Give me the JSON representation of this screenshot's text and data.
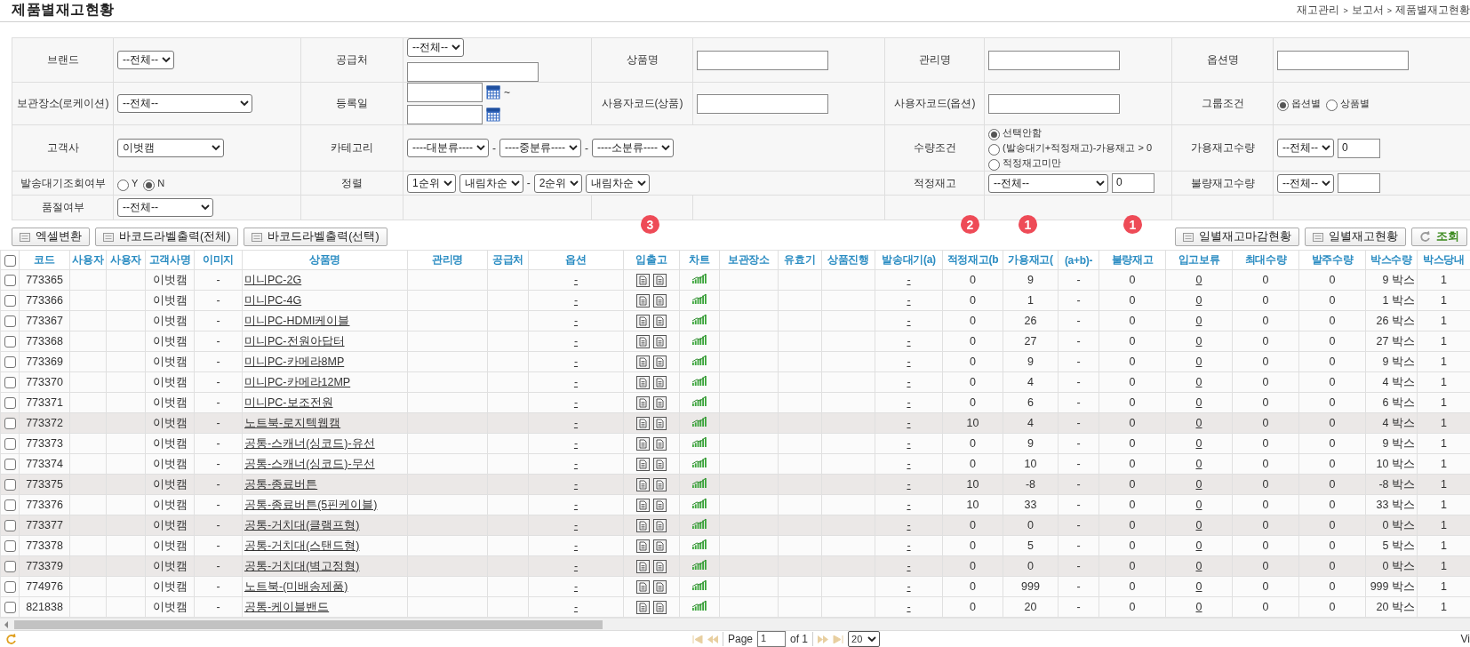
{
  "title": "제품별재고현황",
  "breadcrumb": [
    "재고관리",
    ">",
    "보고서",
    ">",
    "제품별재고현황"
  ],
  "filter": {
    "rows": [
      {
        "cells": [
          {
            "kind": "label",
            "text": "브랜드"
          },
          {
            "kind": "controls",
            "items": [
              {
                "kind": "select",
                "value": "--전체--"
              }
            ]
          },
          {
            "kind": "label",
            "text": "공급처"
          },
          {
            "kind": "controls",
            "items": [
              {
                "kind": "select",
                "value": "--전체--"
              },
              {
                "kind": "break"
              },
              {
                "kind": "input"
              }
            ]
          },
          {
            "kind": "label",
            "text": "상품명"
          },
          {
            "kind": "controls",
            "items": [
              {
                "kind": "input"
              }
            ]
          },
          {
            "kind": "label",
            "text": "관리명"
          },
          {
            "kind": "controls",
            "items": [
              {
                "kind": "input"
              }
            ]
          },
          {
            "kind": "label",
            "text": "옵션명"
          },
          {
            "kind": "controls",
            "items": [
              {
                "kind": "input"
              }
            ]
          }
        ]
      },
      {
        "cells": [
          {
            "kind": "label",
            "text": "보관장소(로케이션)"
          },
          {
            "kind": "controls",
            "items": [
              {
                "kind": "select",
                "value": "--전체--"
              }
            ]
          },
          {
            "kind": "label",
            "text": "등록일"
          },
          {
            "kind": "controls",
            "items": [
              {
                "kind": "input"
              },
              {
                "kind": "calendar"
              },
              {
                "kind": "text",
                "text": "~"
              },
              {
                "kind": "input"
              },
              {
                "kind": "calendar"
              }
            ]
          },
          {
            "kind": "label",
            "text": "사용자코드(상품)"
          },
          {
            "kind": "controls",
            "items": [
              {
                "kind": "input"
              }
            ]
          },
          {
            "kind": "label",
            "text": "사용자코드(옵션)"
          },
          {
            "kind": "controls",
            "items": [
              {
                "kind": "input"
              }
            ]
          },
          {
            "kind": "label",
            "text": "그룹조건"
          },
          {
            "kind": "controls",
            "items": [
              {
                "kind": "radio",
                "label": "옵션별",
                "selected": true
              },
              {
                "kind": "radio",
                "label": "상품별",
                "selected": false
              }
            ]
          }
        ]
      },
      {
        "cells": [
          {
            "kind": "label",
            "text": "고객사"
          },
          {
            "kind": "controls",
            "items": [
              {
                "kind": "select",
                "value": "이벗캠"
              }
            ]
          },
          {
            "kind": "label",
            "text": "카테고리"
          },
          {
            "kind": "controls",
            "colspan": 3,
            "items": [
              {
                "kind": "select",
                "value": "----대분류----"
              },
              {
                "kind": "text",
                "text": "-"
              },
              {
                "kind": "select",
                "value": "----중분류----"
              },
              {
                "kind": "text",
                "text": "-"
              },
              {
                "kind": "select",
                "value": "----소분류----"
              }
            ]
          },
          {
            "kind": "label",
            "text": "수량조건"
          },
          {
            "kind": "controls",
            "items": [
              {
                "kind": "radio",
                "label": "선택안함",
                "selected": true
              },
              {
                "kind": "radio",
                "label": "(발송대기+적정재고)-가용재고 > 0",
                "selected": false
              },
              {
                "kind": "radio",
                "label": "적정재고미만",
                "selected": false
              }
            ]
          },
          {
            "kind": "label",
            "text": "가용재고수량"
          },
          {
            "kind": "controls",
            "items": [
              {
                "kind": "select",
                "value": "--전체--"
              },
              {
                "kind": "input",
                "value": "0"
              }
            ]
          }
        ]
      },
      {
        "cells": [
          {
            "kind": "label",
            "text": "발송대기조회여부"
          },
          {
            "kind": "controls",
            "items": [
              {
                "kind": "radio",
                "label": "Y",
                "selected": false
              },
              {
                "kind": "radio",
                "label": "N",
                "selected": true
              }
            ]
          },
          {
            "kind": "label",
            "text": "정렬"
          },
          {
            "kind": "controls",
            "colspan": 3,
            "items": [
              {
                "kind": "select",
                "value": "1순위"
              },
              {
                "kind": "select",
                "value": "내림차순"
              },
              {
                "kind": "text",
                "text": "-"
              },
              {
                "kind": "select",
                "value": "2순위"
              },
              {
                "kind": "select",
                "value": "내림차순"
              }
            ]
          },
          {
            "kind": "label",
            "text": "적정재고"
          },
          {
            "kind": "controls",
            "items": [
              {
                "kind": "select",
                "value": "--전체--"
              },
              {
                "kind": "input",
                "value": "0"
              }
            ]
          },
          {
            "kind": "label",
            "text": "불량재고수량"
          },
          {
            "kind": "controls",
            "items": [
              {
                "kind": "select",
                "value": "--전체--"
              },
              {
                "kind": "input"
              }
            ]
          }
        ]
      },
      {
        "cells": [
          {
            "kind": "label",
            "text": "품절여부"
          },
          {
            "kind": "controls",
            "items": [
              {
                "kind": "select",
                "value": "--전체--"
              }
            ]
          },
          {
            "kind": "empty"
          },
          {
            "kind": "empty"
          },
          {
            "kind": "empty"
          },
          {
            "kind": "empty"
          },
          {
            "kind": "empty"
          },
          {
            "kind": "empty"
          },
          {
            "kind": "empty"
          },
          {
            "kind": "empty"
          }
        ]
      }
    ]
  },
  "left_buttons": [
    "엑셀변환",
    "바코드라벨출력(전체)",
    "바코드라벨출력(선택)"
  ],
  "right_buttons": [
    {
      "kind": "plain",
      "label": "일별재고마감현황"
    },
    {
      "kind": "plain",
      "label": "일별재고현황"
    },
    {
      "kind": "search",
      "label": "조회"
    }
  ],
  "markers": [
    "3",
    "2",
    "1",
    "1"
  ],
  "table": {
    "select_all_checked": false,
    "columns": [
      "코드",
      "사용자",
      "사용자",
      "고객사명",
      "이미지",
      "상품명",
      "관리명",
      "공급처",
      "옵션",
      "입출고",
      "차트",
      "보관장소",
      "유효기",
      "상품진행",
      "발송대기(a)",
      "적정재고(b",
      "가용재고(",
      "(a+b)-",
      "불량재고",
      "입고보류",
      "최대수량",
      "발주수량",
      "박스수량",
      "박스당내"
    ],
    "rows": [
      {
        "checked": false,
        "highlighted": false,
        "code": "773365",
        "customer": "이벗캠",
        "image": "-",
        "product": "미니PC-2G",
        "option": "-",
        "waiting": "-",
        "optimal": "0",
        "available": "9",
        "diff": "-",
        "defective": "0",
        "hold": "0",
        "max": "0",
        "order": "0",
        "boxes": "9 박스",
        "per_box": "1"
      },
      {
        "checked": false,
        "highlighted": false,
        "code": "773366",
        "customer": "이벗캠",
        "image": "-",
        "product": "미니PC-4G",
        "option": "-",
        "waiting": "-",
        "optimal": "0",
        "available": "1",
        "diff": "-",
        "defective": "0",
        "hold": "0",
        "max": "0",
        "order": "0",
        "boxes": "1 박스",
        "per_box": "1"
      },
      {
        "checked": false,
        "highlighted": false,
        "code": "773367",
        "customer": "이벗캠",
        "image": "-",
        "product": "미니PC-HDMI케이블",
        "option": "-",
        "waiting": "-",
        "optimal": "0",
        "available": "26",
        "diff": "-",
        "defective": "0",
        "hold": "0",
        "max": "0",
        "order": "0",
        "boxes": "26 박스",
        "per_box": "1"
      },
      {
        "checked": false,
        "highlighted": false,
        "code": "773368",
        "customer": "이벗캠",
        "image": "-",
        "product": "미니PC-전원아답터",
        "option": "-",
        "waiting": "-",
        "optimal": "0",
        "available": "27",
        "diff": "-",
        "defective": "0",
        "hold": "0",
        "max": "0",
        "order": "0",
        "boxes": "27 박스",
        "per_box": "1"
      },
      {
        "checked": false,
        "highlighted": false,
        "code": "773369",
        "customer": "이벗캠",
        "image": "-",
        "product": "미니PC-카메라8MP",
        "option": "-",
        "waiting": "-",
        "optimal": "0",
        "available": "9",
        "diff": "-",
        "defective": "0",
        "hold": "0",
        "max": "0",
        "order": "0",
        "boxes": "9 박스",
        "per_box": "1"
      },
      {
        "checked": false,
        "highlighted": false,
        "code": "773370",
        "customer": "이벗캠",
        "image": "-",
        "product": "미니PC-카메라12MP",
        "option": "-",
        "waiting": "-",
        "optimal": "0",
        "available": "4",
        "diff": "-",
        "defective": "0",
        "hold": "0",
        "max": "0",
        "order": "0",
        "boxes": "4 박스",
        "per_box": "1"
      },
      {
        "checked": false,
        "highlighted": false,
        "code": "773371",
        "customer": "이벗캠",
        "image": "-",
        "product": "미니PC-보조전원",
        "option": "-",
        "waiting": "-",
        "optimal": "0",
        "available": "6",
        "diff": "-",
        "defective": "0",
        "hold": "0",
        "max": "0",
        "order": "0",
        "boxes": "6 박스",
        "per_box": "1"
      },
      {
        "checked": false,
        "highlighted": true,
        "code": "773372",
        "customer": "이벗캠",
        "image": "-",
        "product": "노트북-로지텍웹캠",
        "option": "-",
        "waiting": "-",
        "optimal": "10",
        "available": "4",
        "diff": "-",
        "defective": "0",
        "hold": "0",
        "max": "0",
        "order": "0",
        "boxes": "4 박스",
        "per_box": "1"
      },
      {
        "checked": false,
        "highlighted": false,
        "code": "773373",
        "customer": "이벗캠",
        "image": "-",
        "product": "공통-스캐너(싱코드)-유선",
        "option": "-",
        "waiting": "-",
        "optimal": "0",
        "available": "9",
        "diff": "-",
        "defective": "0",
        "hold": "0",
        "max": "0",
        "order": "0",
        "boxes": "9 박스",
        "per_box": "1"
      },
      {
        "checked": false,
        "highlighted": false,
        "code": "773374",
        "customer": "이벗캠",
        "image": "-",
        "product": "공통-스캐너(싱코드)-무선",
        "option": "-",
        "waiting": "-",
        "optimal": "0",
        "available": "10",
        "diff": "-",
        "defective": "0",
        "hold": "0",
        "max": "0",
        "order": "0",
        "boxes": "10 박스",
        "per_box": "1"
      },
      {
        "checked": false,
        "highlighted": true,
        "code": "773375",
        "customer": "이벗캠",
        "image": "-",
        "product": "공통-종료버튼",
        "option": "-",
        "waiting": "-",
        "optimal": "10",
        "available": "-8",
        "diff": "-",
        "defective": "0",
        "hold": "0",
        "max": "0",
        "order": "0",
        "boxes": "-8 박스",
        "per_box": "1"
      },
      {
        "checked": false,
        "highlighted": false,
        "code": "773376",
        "customer": "이벗캠",
        "image": "-",
        "product": "공통-종료버튼(5핀케이블)",
        "option": "-",
        "waiting": "-",
        "optimal": "10",
        "available": "33",
        "diff": "-",
        "defective": "0",
        "hold": "0",
        "max": "0",
        "order": "0",
        "boxes": "33 박스",
        "per_box": "1"
      },
      {
        "checked": false,
        "highlighted": true,
        "code": "773377",
        "customer": "이벗캠",
        "image": "-",
        "product": "공통-거치대(클램프형)",
        "option": "-",
        "waiting": "-",
        "optimal": "0",
        "available": "0",
        "diff": "-",
        "defective": "0",
        "hold": "0",
        "max": "0",
        "order": "0",
        "boxes": "0 박스",
        "per_box": "1"
      },
      {
        "checked": false,
        "highlighted": false,
        "code": "773378",
        "customer": "이벗캠",
        "image": "-",
        "product": "공통-거치대(스탠드형)",
        "option": "-",
        "waiting": "-",
        "optimal": "0",
        "available": "5",
        "diff": "-",
        "defective": "0",
        "hold": "0",
        "max": "0",
        "order": "0",
        "boxes": "5 박스",
        "per_box": "1"
      },
      {
        "checked": false,
        "highlighted": true,
        "code": "773379",
        "customer": "이벗캠",
        "image": "-",
        "product": "공통-거치대(벽고정형)",
        "option": "-",
        "waiting": "-",
        "optimal": "0",
        "available": "0",
        "diff": "-",
        "defective": "0",
        "hold": "0",
        "max": "0",
        "order": "0",
        "boxes": "0 박스",
        "per_box": "1"
      },
      {
        "checked": false,
        "highlighted": false,
        "code": "774976",
        "customer": "이벗캠",
        "image": "-",
        "product": "노트북-(미배송제품)",
        "option": "-",
        "waiting": "-",
        "optimal": "0",
        "available": "999",
        "diff": "-",
        "defective": "0",
        "hold": "0",
        "max": "0",
        "order": "0",
        "boxes": "999 박스",
        "per_box": "1"
      },
      {
        "checked": false,
        "highlighted": false,
        "code": "821838",
        "customer": "이벗캠",
        "image": "-",
        "product": "공통-케이블밴드",
        "option": "-",
        "waiting": "-",
        "optimal": "0",
        "available": "20",
        "diff": "-",
        "defective": "0",
        "hold": "0",
        "max": "0",
        "order": "0",
        "boxes": "20 박스",
        "per_box": "1"
      }
    ]
  },
  "pager": {
    "page_label": "Page",
    "page": "1",
    "of_label": "of 1",
    "per_page": "20",
    "info": "Vi"
  }
}
